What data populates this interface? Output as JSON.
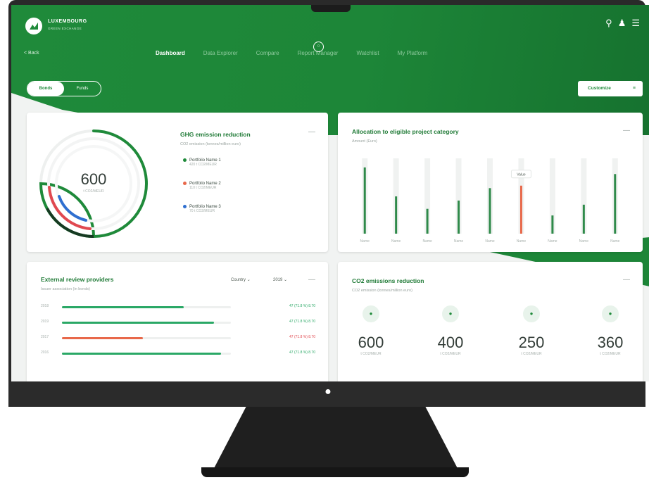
{
  "header": {
    "brand_name": "LUXEMBOURG",
    "brand_sub": "GREEN EXCHANGE",
    "back_label": "< Back",
    "nav": [
      {
        "label": "Dashboard",
        "active": true
      },
      {
        "label": "Data Explorer",
        "active": false
      },
      {
        "label": "Compare",
        "active": false
      },
      {
        "label": "Report Manager",
        "active": false
      },
      {
        "label": "Watchlist",
        "active": false
      },
      {
        "label": "My Platform",
        "active": false
      }
    ],
    "toggle": {
      "left": "Bonds",
      "right": "Funds"
    },
    "customize_label": "Customize",
    "accent": "#1f8a3a"
  },
  "card_ghg": {
    "title": "GHG emission reduction",
    "subtitle": "CO2 emission (tonnes/million euro)",
    "total": "600",
    "total_unit": "t CO2/MEUR",
    "items": [
      {
        "name": "Portfolio Name 1",
        "sub": "420 t CO2/MEUR",
        "color": "#1f8a3a"
      },
      {
        "name": "Portfolio Name 2",
        "sub": "110 t CO2/MEUR",
        "color": "#e8684a"
      },
      {
        "name": "Portfolio Name 3",
        "sub": "70 t CO2/MEUR",
        "color": "#2f6fd0"
      }
    ],
    "menu_glyph": "—"
  },
  "card_allocation": {
    "title": "Allocation to eligible project category",
    "subtitle": "Amount (Euro)",
    "tooltip": "Value",
    "menu_glyph": "—"
  },
  "chart_data": {
    "type": "bar",
    "categories": [
      "Name",
      "Name",
      "Name",
      "Name",
      "Name",
      "Name",
      "Name",
      "Name",
      "Name"
    ],
    "values": [
      80,
      45,
      30,
      40,
      55,
      58,
      22,
      35,
      72
    ],
    "highlight_index": 5,
    "colors": {
      "bar": "#2f8a4a",
      "highlight": "#e8684a"
    }
  },
  "card_review": {
    "title": "External review providers",
    "subtitle": "Issuer association (in bonds)",
    "dropdown1": "Country",
    "dropdown2": "2019",
    "menu_glyph": "—",
    "rows": [
      {
        "label": "2018",
        "fill": 0.72,
        "color": "#2aa866",
        "value": "47 (71.8 %) 8.70"
      },
      {
        "label": "2019",
        "fill": 0.9,
        "color": "#2aa866",
        "value": "47 (71.8 %) 8.70"
      },
      {
        "label": "2017",
        "fill": 0.48,
        "color": "#e8684a",
        "value": "47 (71.8 %) 8.70"
      },
      {
        "label": "2016",
        "fill": 0.94,
        "color": "#2aa866",
        "value": "47 (71.8 %) 8.70"
      }
    ]
  },
  "card_co2": {
    "title": "CO2 emissions reduction",
    "subtitle": "CO2 emission (tonnes/million euro)",
    "menu_glyph": "—",
    "stats": [
      {
        "value": "600",
        "unit": "t CO2/MEUR"
      },
      {
        "value": "400",
        "unit": "t CO2/MEUR"
      },
      {
        "value": "250",
        "unit": "t CO2/MEUR"
      },
      {
        "value": "360",
        "unit": "t CO2/MEUR"
      }
    ]
  }
}
